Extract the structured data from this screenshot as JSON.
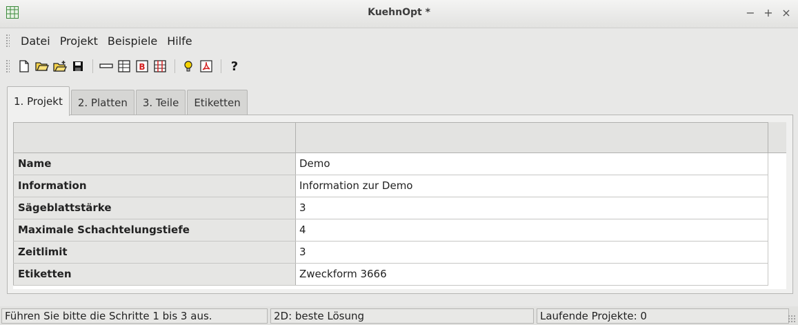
{
  "window": {
    "title": "KuehnOpt *"
  },
  "window_controls": {
    "minimize": "−",
    "maximize": "+",
    "close": "×"
  },
  "menu": [
    {
      "label": "Datei"
    },
    {
      "label": "Projekt"
    },
    {
      "label": "Beispiele"
    },
    {
      "label": "Hilfe"
    }
  ],
  "toolbar": {
    "icons": [
      "new-document-icon",
      "open-folder-icon",
      "open-folder-add-icon",
      "save-icon",
      "remove-row-icon",
      "table-icon",
      "red-b-icon",
      "grid-layout-icon",
      "lightbulb-icon",
      "pdf-icon",
      "help-icon"
    ],
    "help_label": "?"
  },
  "tabs": [
    {
      "label": "1. Projekt",
      "active": true
    },
    {
      "label": "2. Platten",
      "active": false
    },
    {
      "label": "3. Teile",
      "active": false
    },
    {
      "label": "Etiketten",
      "active": false
    }
  ],
  "table": {
    "rows": [
      {
        "key": "Name",
        "value": "Demo"
      },
      {
        "key": "Information",
        "value": "Information zur Demo"
      },
      {
        "key": "Sägeblattstärke",
        "value": "3"
      },
      {
        "key": "Maximale Schachtelungstiefe",
        "value": "4"
      },
      {
        "key": "Zeitlimit",
        "value": "3"
      },
      {
        "key": "Etiketten",
        "value": "Zweckform 3666"
      }
    ]
  },
  "status": {
    "hint": "Führen Sie bitte die Schritte 1 bis 3 aus.",
    "mode": "2D: beste Lösung",
    "running": "Laufende Projekte: 0"
  },
  "colors": {
    "accent_yellow": "#e8c200",
    "pdf_red": "#d42020",
    "table_header": "#e3e3e1"
  }
}
